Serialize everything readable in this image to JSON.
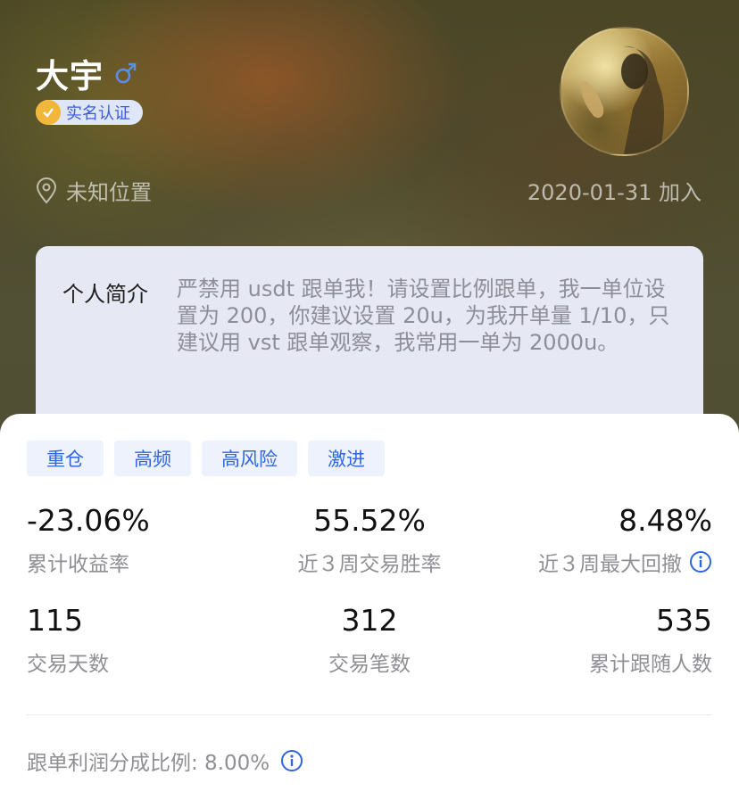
{
  "profile": {
    "name": "大宇",
    "gender_symbol": "♂",
    "verify_label": "实名认证",
    "location": "未知位置",
    "joined": "2020-01-31 加入",
    "bio_title": "个人简介",
    "bio_text": "严禁用 usdt 跟单我！请设置比例跟单，我一单位设置为 200，你建议设置 20u，为我开单量 1/10，只建议用 vst 跟单观察，我常用一单为 2000u。"
  },
  "tags": [
    "重仓",
    "高频",
    "高风险",
    "激进"
  ],
  "stats": {
    "cumulative_return": {
      "value": "-23.06%",
      "label": "累计收益率"
    },
    "win_rate_3w": {
      "value": "55.52%",
      "label": "近３周交易胜率"
    },
    "max_drawdown_3w": {
      "value": "8.48%",
      "label": "近３周最大回撤"
    },
    "trading_days": {
      "value": "115",
      "label": "交易天数"
    },
    "trade_count": {
      "value": "312",
      "label": "交易笔数"
    },
    "followers": {
      "value": "535",
      "label": "累计跟随人数"
    }
  },
  "profit_share": {
    "text": "跟单利润分成比例: 8.00%"
  },
  "colors": {
    "accent": "#2f66e0",
    "badge": "#f2b63a"
  },
  "icons": [
    "gender-male-icon",
    "check-icon",
    "location-pin-icon",
    "info-icon"
  ]
}
